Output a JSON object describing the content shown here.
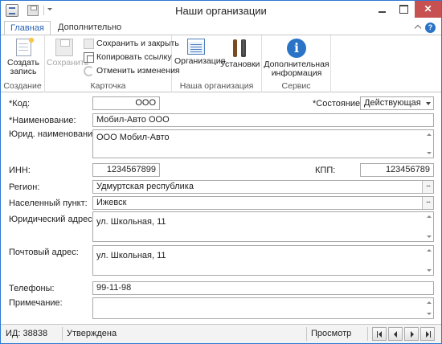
{
  "window": {
    "title": "Наши организации"
  },
  "ribbon": {
    "tabs": [
      {
        "label": "Главная",
        "active": true
      },
      {
        "label": "Дополнительно",
        "active": false
      }
    ],
    "help_label": "?",
    "groups": {
      "create": {
        "label": "Создание",
        "create_button": "Создать запись"
      },
      "card": {
        "label": "Карточка",
        "save_button": "Сохранить",
        "save_close_button": "Сохранить и закрыть",
        "copy_link_button": "Копировать ссылку",
        "undo_button": "Отменить изменения"
      },
      "org": {
        "label": "Наша организация",
        "organization_button": "Организация",
        "settings_button": "Установки"
      },
      "service": {
        "label": "Сервис",
        "info_button": "Дополнительная информация",
        "info_icon": "i"
      }
    }
  },
  "form": {
    "code": {
      "label": "*Код:",
      "value": "ООО"
    },
    "state": {
      "label": "*Состояние:",
      "value": "Действующая"
    },
    "name": {
      "label": "*Наименование:",
      "value": "Мобил-Авто ООО"
    },
    "legal_name": {
      "label": "Юрид. наименование:",
      "value": "ООО Мобил-Авто"
    },
    "inn": {
      "label": "ИНН:",
      "value": "1234567899"
    },
    "kpp": {
      "label": "КПП:",
      "value": "123456789"
    },
    "region": {
      "label": "Регион:",
      "value": "Удмуртская республика"
    },
    "locality": {
      "label": "Населенный пункт:",
      "value": "Ижевск"
    },
    "legal_address": {
      "label": "Юридический адрес:",
      "value": "ул. Школьная, 11"
    },
    "postal_address": {
      "label": "Почтовый адрес:",
      "value": "ул. Школьная, 11"
    },
    "phones": {
      "label": "Телефоны:",
      "value": "99-11-98"
    },
    "note": {
      "label": "Примечание:",
      "value": ""
    },
    "ellipsis_label": "..."
  },
  "statusbar": {
    "id_text": "ИД: 38838",
    "status_text": "Утверждена",
    "mode_text": "Просмотр"
  },
  "colors": {
    "accent": "#2b79d3",
    "close_button": "#c75050",
    "info_icon": "#2a73c6"
  }
}
